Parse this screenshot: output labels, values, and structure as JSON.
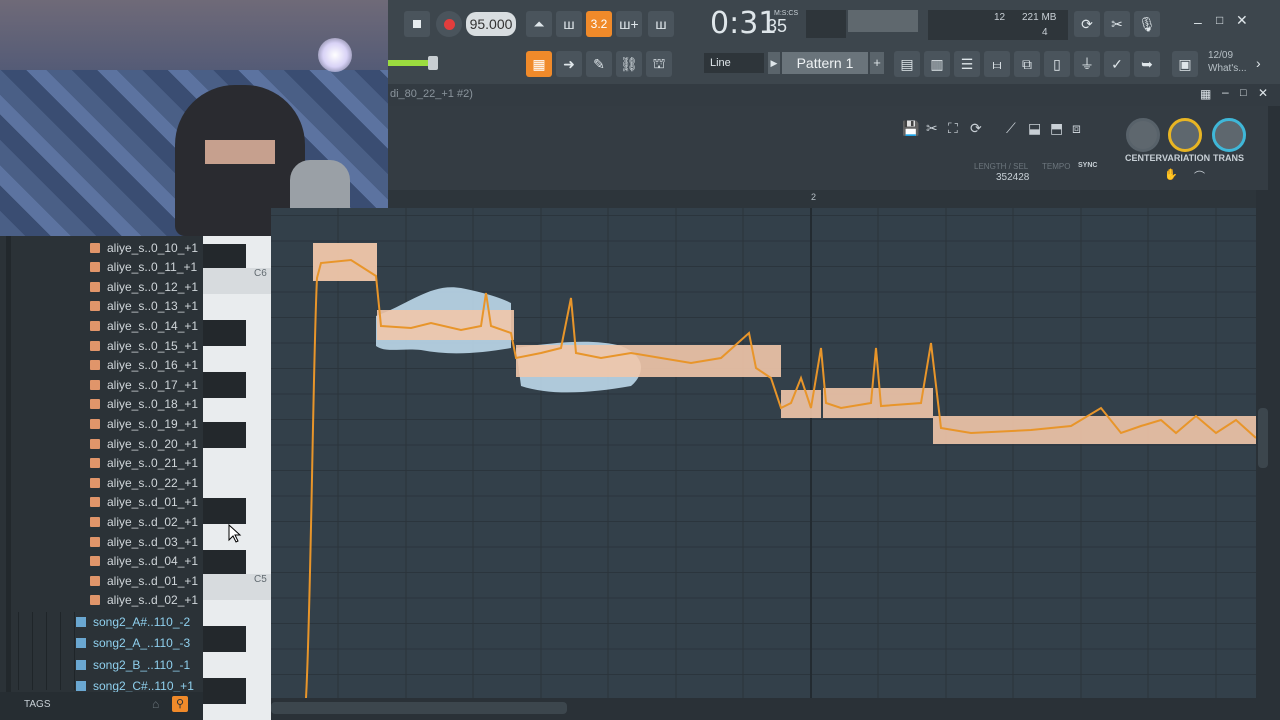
{
  "toolbar": {
    "tempo": "95.000",
    "song_position": "0:31",
    "song_position_fraction": "35",
    "time_format": "M:S:CS",
    "cpu_value": "12",
    "ram_value": "221 MB",
    "poly_value": "4",
    "snap_mode": "Line",
    "pattern_name": "Pattern 1",
    "news_date": "12/09",
    "news_text": "What's...",
    "record_color": "#e23d3d",
    "accent_color": "#f08a2a"
  },
  "piano_roll": {
    "window_title": "di_80_22_+1 #2)",
    "length_sel_label": "LENGTH / SEL",
    "tempo_label": "TEMPO",
    "sync_label": "SYNC",
    "length_value": "352428",
    "bar_marker": "2",
    "knobs": [
      {
        "label": "CENTER"
      },
      {
        "label": "VARIATION"
      },
      {
        "label": "TRANS"
      }
    ],
    "key_labels": [
      "C6",
      "C5"
    ]
  },
  "browser": {
    "items": [
      "aliye_s..0_10_+1",
      "aliye_s..0_11_+1",
      "aliye_s..0_12_+1",
      "aliye_s..0_13_+1",
      "aliye_s..0_14_+1",
      "aliye_s..0_15_+1",
      "aliye_s..0_16_+1",
      "aliye_s..0_17_+1",
      "aliye_s..0_18_+1",
      "aliye_s..0_19_+1",
      "aliye_s..0_20_+1",
      "aliye_s..0_21_+1",
      "aliye_s..0_22_+1",
      "aliye_s..d_01_+1",
      "aliye_s..d_02_+1",
      "aliye_s..d_03_+1",
      "aliye_s..d_04_+1",
      "aliye_s..d_01_+1",
      "aliye_s..d_02_+1"
    ],
    "songs": [
      "song2_A#..110_-2",
      "song2_A_..110_-3",
      "song2_B_..110_-1",
      "song2_C#..110_+1"
    ],
    "tags_label": "TAGS"
  }
}
